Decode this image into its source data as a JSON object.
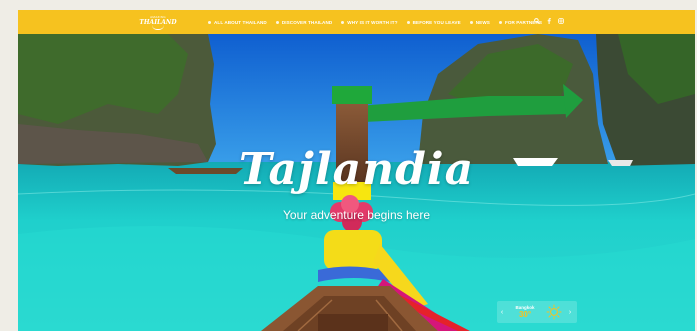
{
  "header": {
    "logo_small": "AMAZING",
    "logo_main": "THAILAND",
    "nav": [
      {
        "label": "ALL ABOUT THAILAND"
      },
      {
        "label": "DISCOVER THAILAND"
      },
      {
        "label": "WHY IS IT WORTH IT?"
      },
      {
        "label": "BEFORE YOU LEAVE"
      },
      {
        "label": "NEWS"
      },
      {
        "label": "FOR PARTNERS"
      }
    ],
    "icons": [
      "search-icon",
      "facebook-icon",
      "instagram-icon"
    ]
  },
  "hero": {
    "title": "Tajlandia",
    "subtitle": "Your adventure begins here"
  },
  "weather": {
    "city": "Bangkok",
    "temp": "30°",
    "icon": "sun-icon"
  },
  "colors": {
    "brand_yellow": "#f6c21f",
    "sea_turquoise": "#1fc6c8",
    "sky_blue": "#1f7ed8"
  }
}
